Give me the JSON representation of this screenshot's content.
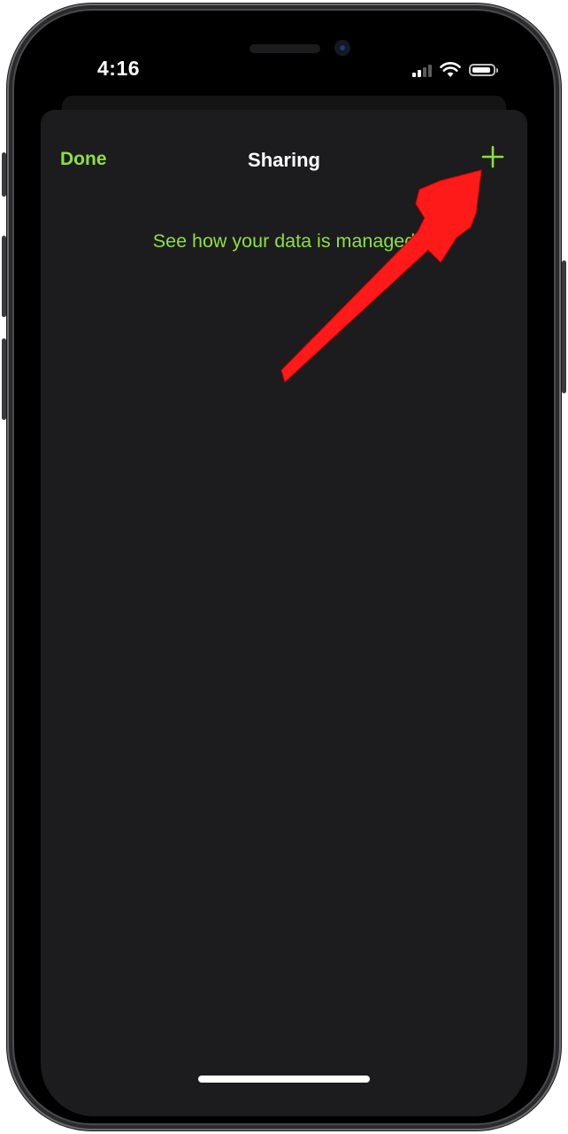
{
  "status_bar": {
    "time": "4:16",
    "icons": [
      "cellular-signal-icon",
      "wifi-icon",
      "battery-icon"
    ]
  },
  "nav": {
    "done_label": "Done",
    "title": "Sharing",
    "add_icon": "plus-icon"
  },
  "content": {
    "info_link": "See how your data is managed"
  },
  "colors": {
    "accent": "#8ee03e",
    "sheet_background": "#1c1c1e",
    "annotation_arrow": "#ff1a1a"
  }
}
